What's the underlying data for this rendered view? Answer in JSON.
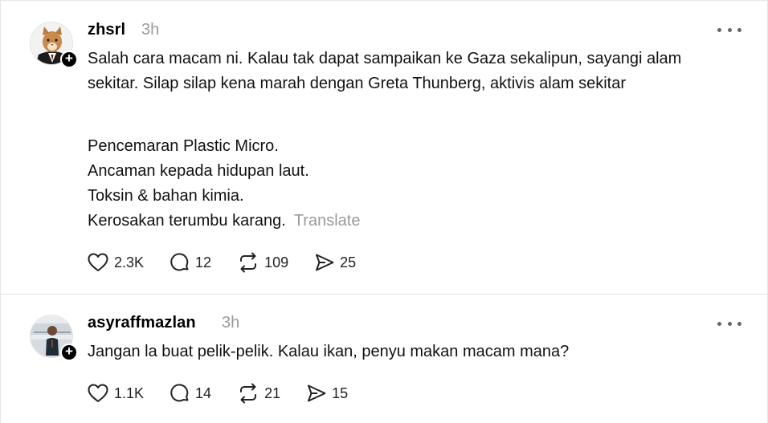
{
  "posts": [
    {
      "username": "zhsrl",
      "time": "3h",
      "text_paragraphs": [
        "Salah cara macam ni. Kalau tak dapat sampaikan ke Gaza sekalipun, sayangi alam sekitar. Silap silap kena marah dengan Greta Thunberg, aktivis alam sekitar"
      ],
      "list_lines": [
        "Pencemaran Plastic Micro.",
        "Ancaman kepada hidupan laut.",
        "Toksin & bahan kimia.",
        "Kerosakan terumbu karang."
      ],
      "translate_label": "Translate",
      "likes": "2.3K",
      "replies": "12",
      "reposts": "109",
      "shares": "25"
    },
    {
      "username": "asyraffmazlan",
      "time": "3h",
      "text": "Jangan la buat pelik-pelik. Kalau ikan, penyu makan macam mana?",
      "likes": "1.1K",
      "replies": "14",
      "reposts": "21",
      "shares": "15"
    }
  ],
  "icons": {
    "like": "heart-icon",
    "reply": "comment-icon",
    "repost": "repost-icon",
    "share": "share-icon",
    "more": "more-options-icon",
    "follow": "plus-icon"
  },
  "colors": {
    "muted": "#9a9a9a",
    "text": "#111111",
    "divider": "#e3e3e3"
  }
}
